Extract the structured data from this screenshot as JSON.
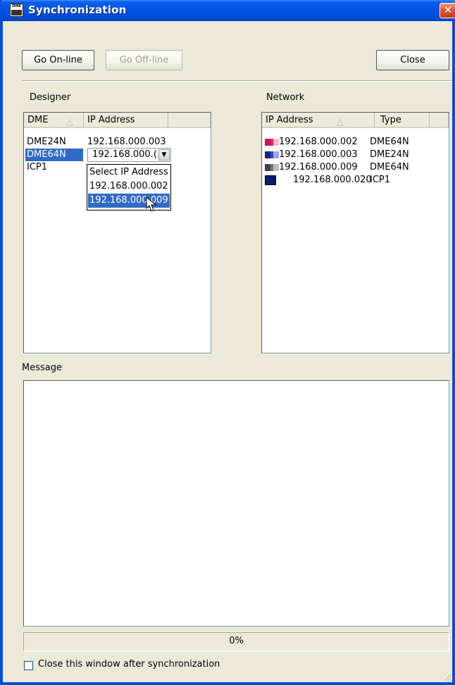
{
  "window": {
    "title": "Synchronization",
    "icon_label": "DME"
  },
  "toolbar": {
    "go_online": "Go On-line",
    "go_offline": "Go Off-line",
    "close": "Close"
  },
  "designer": {
    "label": "Designer",
    "columns": [
      "DME",
      "IP Address"
    ],
    "rows": [
      {
        "dme": "DME24N",
        "ip": "192.168.000.003"
      },
      {
        "dme": "DME64N",
        "ip": "192.168.000.("
      },
      {
        "dme": "ICP1",
        "ip": ""
      }
    ],
    "dropdown": {
      "options": [
        "Select IP Address",
        "192.168.000.002",
        "192.168.000.009"
      ],
      "highlighted": "192.168.000.009"
    }
  },
  "network": {
    "label": "Network",
    "columns": [
      "IP Address",
      "Type"
    ],
    "rows": [
      {
        "ip": "192.168.000.002",
        "type": "DME64N",
        "icon": "dme64n-device-icon",
        "color": "#c2185b"
      },
      {
        "ip": "192.168.000.003",
        "type": "DME24N",
        "icon": "dme24n-device-icon",
        "color": "#1a237e"
      },
      {
        "ip": "192.168.000.009",
        "type": "DME64N",
        "icon": "dme64n-device-icon",
        "color": "#424242"
      },
      {
        "ip": "192.168.000.020",
        "type": "ICP1",
        "icon": "icp1-device-icon",
        "color": "#0d1b6e"
      }
    ]
  },
  "message": {
    "label": "Message",
    "text": ""
  },
  "progress": {
    "value": 0,
    "label": "0%"
  },
  "option": {
    "label": "Close this window after synchronization",
    "checked": false
  },
  "colors": {
    "titlebar": "#0554e3",
    "selection": "#316ac5",
    "face": "#ece9d8"
  }
}
